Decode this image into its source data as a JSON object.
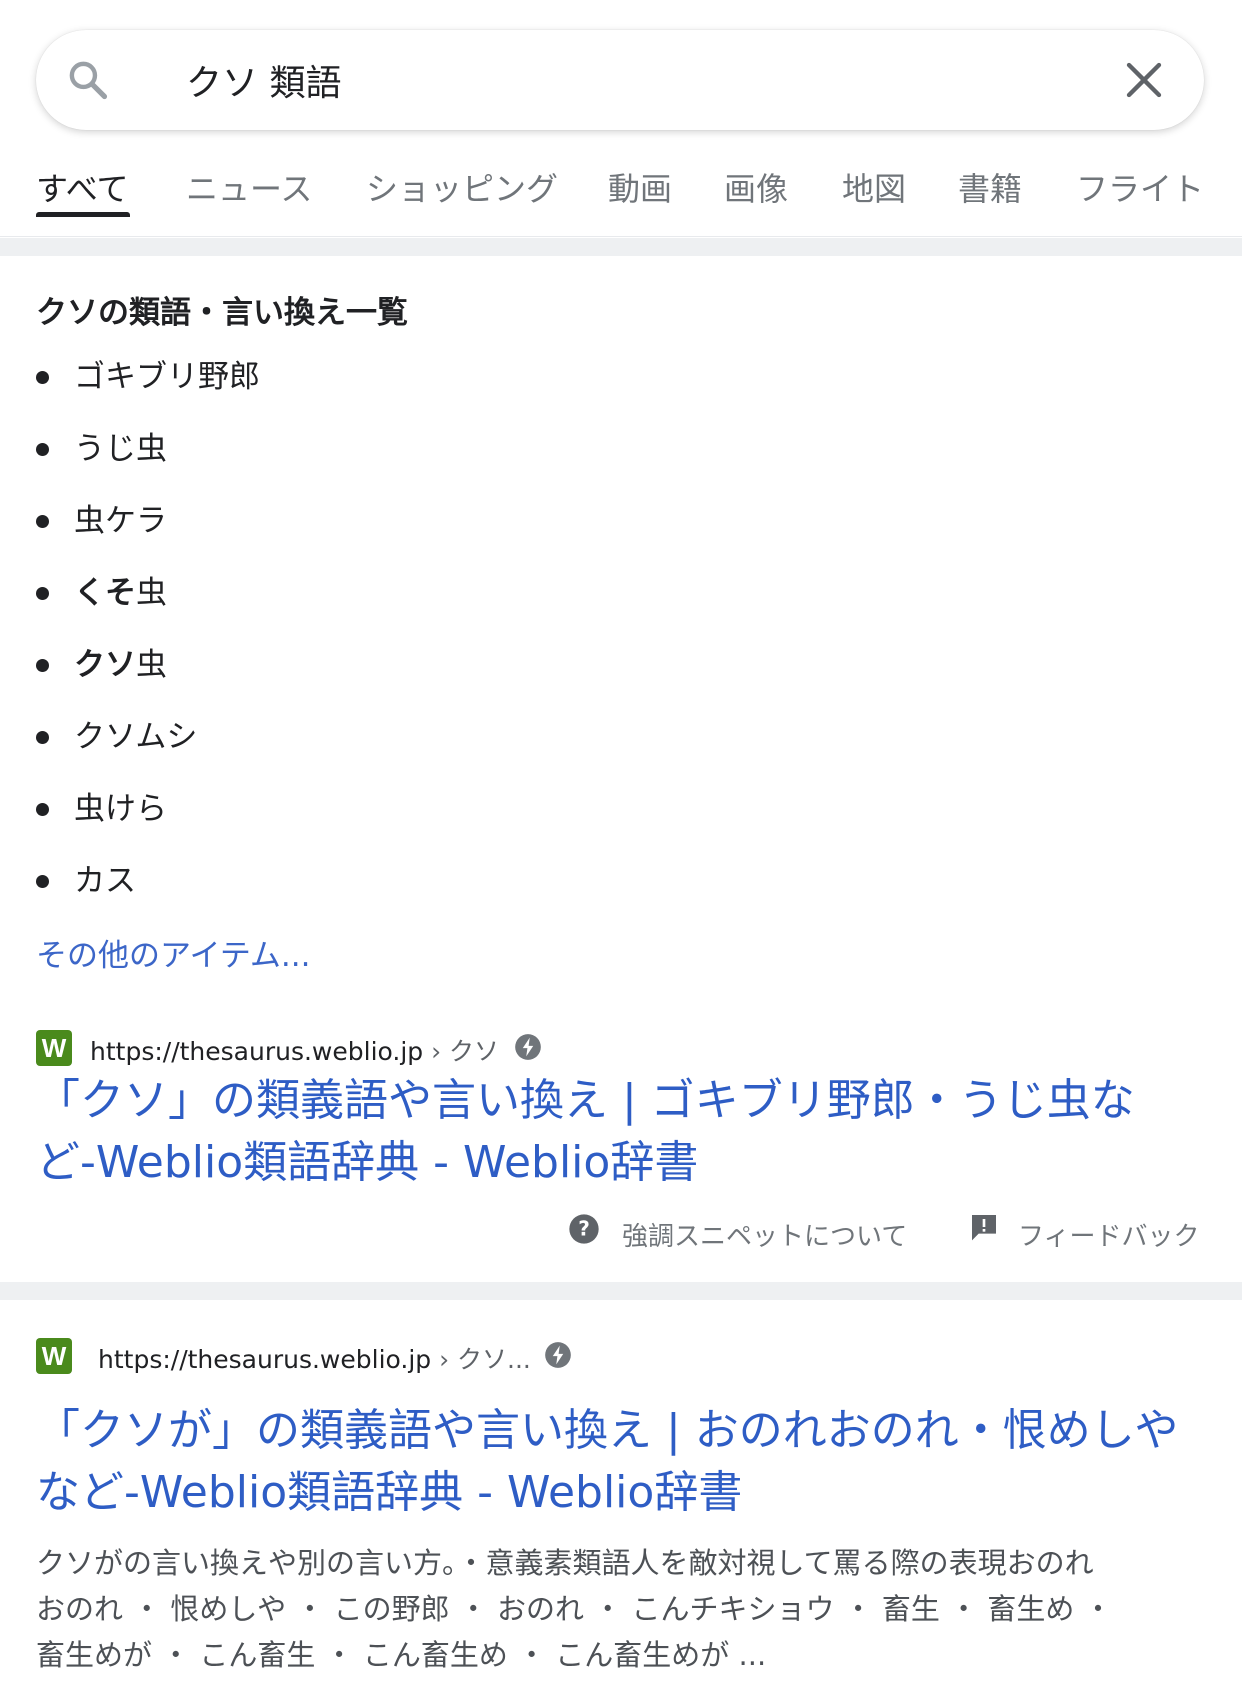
{
  "search": {
    "query": "クソ 類語",
    "placeholder": ""
  },
  "tabs": [
    {
      "label": "すべて",
      "active": true
    },
    {
      "label": "ニュース"
    },
    {
      "label": "ショッピング"
    },
    {
      "label": "動画"
    },
    {
      "label": "画像"
    },
    {
      "label": "地図"
    },
    {
      "label": "書籍"
    },
    {
      "label": "フライト"
    }
  ],
  "snippet": {
    "title": "クソの類語・言い換え一覧",
    "items": [
      {
        "bold": "",
        "text": "ゴキブリ野郎"
      },
      {
        "bold": "",
        "text": "うじ虫"
      },
      {
        "bold": "",
        "text": "虫ケラ"
      },
      {
        "bold": "くそ",
        "text": "虫"
      },
      {
        "bold": "クソ",
        "text": "虫"
      },
      {
        "bold": "",
        "text": "クソムシ"
      },
      {
        "bold": "",
        "text": "虫けら"
      },
      {
        "bold": "",
        "text": "カス"
      }
    ],
    "more_link": "その他のアイテム...",
    "source": {
      "favicon_letter": "W",
      "url": "https://thesaurus.weblio.jp",
      "crumb": "› クソ",
      "title_line1": "「クソ」の類義語や言い換え | ゴキブリ野郎・うじ虫な",
      "title_line2": "ど-Weblio類語辞典 - Weblio辞書"
    },
    "footer": {
      "about": "強調スニペットについて",
      "feedback": "フィードバック"
    }
  },
  "result2": {
    "favicon_letter": "W",
    "url": "https://thesaurus.weblio.jp",
    "crumb": "› クソ...",
    "title_line1": "「クソが」の類義語や言い換え | おのれおのれ・恨めしや",
    "title_line2": "など-Weblio類語辞典 - Weblio辞書",
    "desc_line1": "クソがの言い換えや別の言い方。・意義素類語人を敵対視して罵る際の表現おのれ",
    "desc_line2": "おのれ ・ 恨めしや ・ この野郎 ・ おのれ ・ こんチキショウ ・ 畜生 ・ 畜生め ・",
    "desc_line3": "畜生めが ・ こん畜生 ・ こん畜生め ・ こん畜生めが ..."
  },
  "colors": {
    "link": "#2e5dc5",
    "favicon_bg": "#4a8a1c",
    "separator": "#eef0f2"
  }
}
